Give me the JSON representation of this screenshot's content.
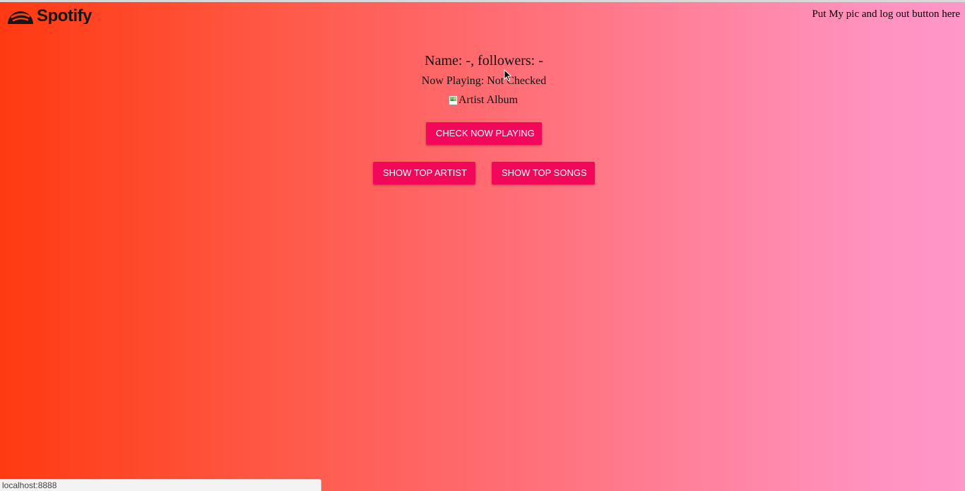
{
  "header": {
    "logo_text": "Spotify",
    "note": "Put My pic and log out button here"
  },
  "profile": {
    "summary": "Name: -, followers: -"
  },
  "now_playing": {
    "text": "Now Playing: Not Checked",
    "album_alt": "Artist Album"
  },
  "buttons": {
    "check_now_playing": "Check Now Playing",
    "show_top_artist": "Show Top Artist",
    "show_top_songs": "Show Top Songs"
  },
  "status_bar": {
    "url": "localhost:8888"
  },
  "icons": {
    "logo": "spotify-logo-icon",
    "broken_image": "broken-image-icon",
    "cursor": "mouse-cursor-icon"
  },
  "colors": {
    "button": "#f2075a",
    "gradient_start": "#ff3a12",
    "gradient_end": "#ff97c9"
  }
}
